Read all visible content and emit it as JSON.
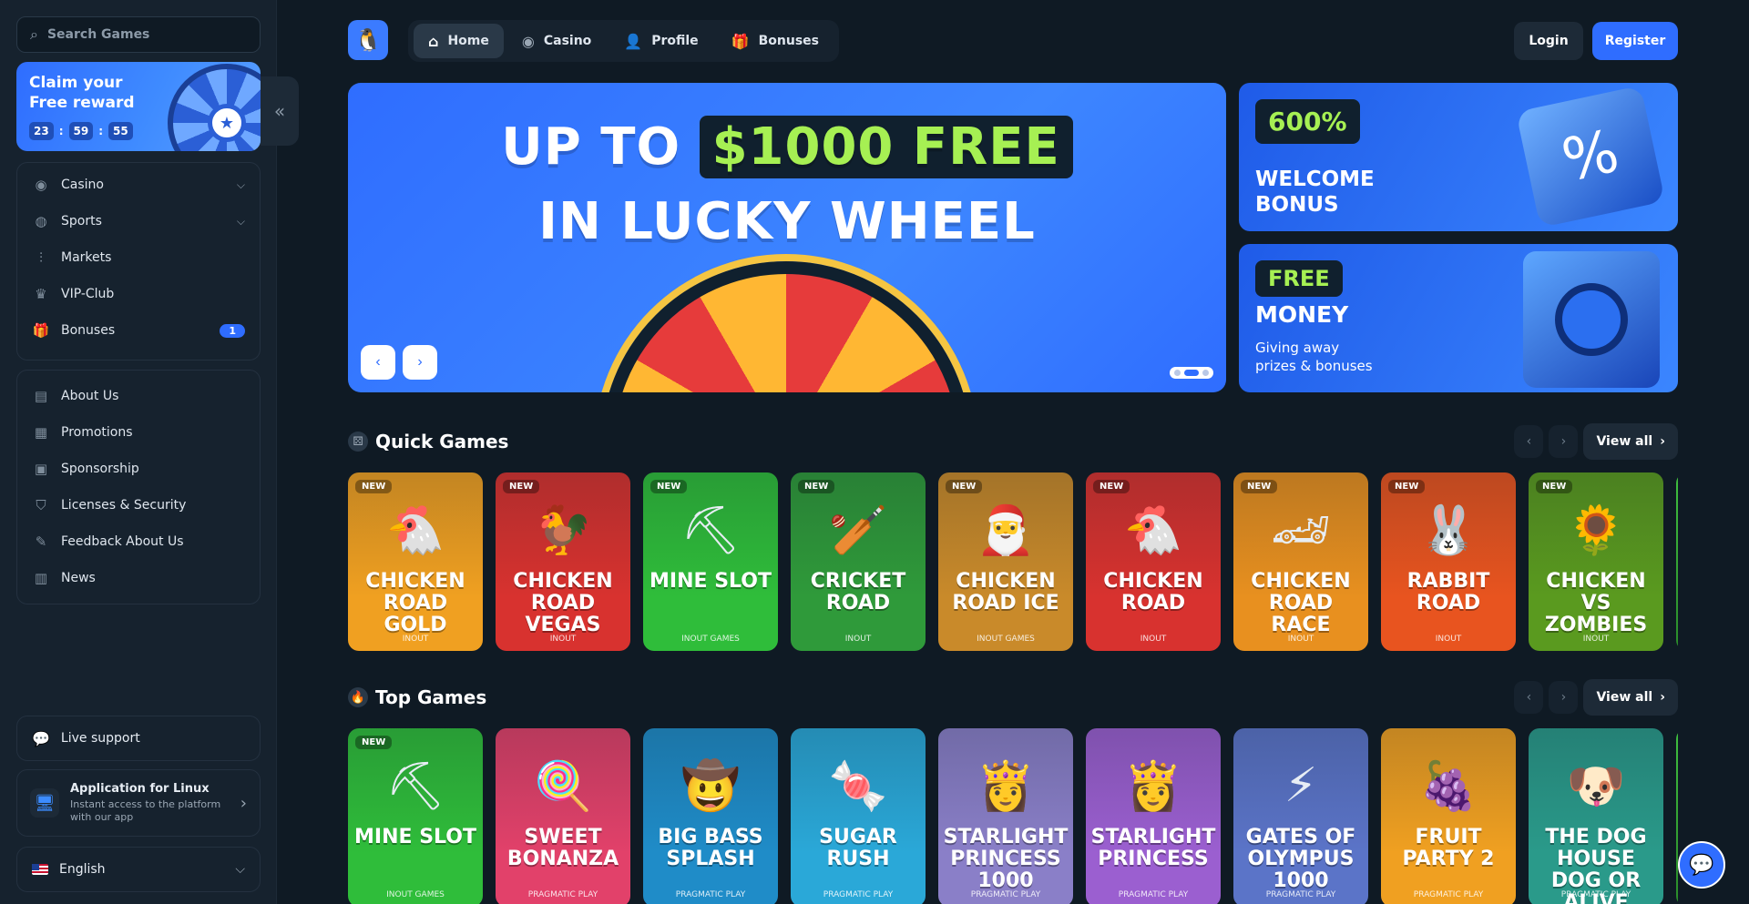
{
  "search": {
    "placeholder": "Search Games"
  },
  "reward": {
    "title": "Claim your Free reward",
    "hours": "23",
    "minutes": "59",
    "seconds": "55",
    "colon": ":"
  },
  "collapse_icon": "«",
  "nav_primary": [
    {
      "label": "Casino",
      "icon": "casino-chip-icon",
      "glyph": "◉",
      "chev": "⌵"
    },
    {
      "label": "Sports",
      "icon": "globe-icon",
      "glyph": "◍",
      "chev": "⌵"
    },
    {
      "label": "Markets",
      "icon": "markets-icon",
      "glyph": "⫶"
    },
    {
      "label": "VIP-Club",
      "icon": "crown-icon",
      "glyph": "♛"
    },
    {
      "label": "Bonuses",
      "icon": "gift-icon",
      "glyph": "🎁",
      "badge": "1"
    }
  ],
  "nav_secondary": [
    {
      "label": "About Us",
      "icon": "book-icon",
      "glyph": "▤"
    },
    {
      "label": "Promotions",
      "icon": "promotions-icon",
      "glyph": "▦"
    },
    {
      "label": "Sponsorship",
      "icon": "sponsorship-icon",
      "glyph": "▣"
    },
    {
      "label": "Licenses & Security",
      "icon": "shield-icon",
      "glyph": "⛉"
    },
    {
      "label": "Feedback About Us",
      "icon": "feedback-icon",
      "glyph": "✎"
    },
    {
      "label": "News",
      "icon": "news-icon",
      "glyph": "▥"
    }
  ],
  "support": {
    "label": "Live support",
    "glyph": "💬"
  },
  "app": {
    "title": "Application for Linux",
    "subtitle": "Instant access to the platform with our app",
    "glyph": "🖥",
    "chev": "›"
  },
  "language": {
    "label": "English",
    "chev": "⌵"
  },
  "topbar": {
    "logo": "🐧",
    "tabs": [
      {
        "label": "Home",
        "glyph": "⌂",
        "active": true
      },
      {
        "label": "Casino",
        "glyph": "◉"
      },
      {
        "label": "Profile",
        "glyph": "👤"
      },
      {
        "label": "Bonuses",
        "glyph": "🎁"
      }
    ],
    "login": "Login",
    "register": "Register"
  },
  "hero": {
    "line1_a": "UP TO",
    "line1_hl": "$1000 FREE",
    "line2": "IN LUCKY WHEEL",
    "prev": "‹",
    "next": "›"
  },
  "promo1": {
    "pill": "600%",
    "title1": "WELCOME",
    "title2": "BONUS",
    "glyph": "%"
  },
  "promo2": {
    "pill": "FREE",
    "title": "MONEY",
    "sub1": "Giving away",
    "sub2": "prizes & bonuses"
  },
  "quick_games": {
    "title": "Quick Games",
    "view_all": "View all",
    "prev": "‹",
    "next": "›",
    "items": [
      {
        "name": "CHICKEN ROAD GOLD",
        "provider": "INOUT",
        "new": "NEW",
        "glyph": "🐔",
        "color": "#f0a021"
      },
      {
        "name": "CHICKEN ROAD VEGAS",
        "provider": "INOUT",
        "new": "NEW",
        "glyph": "🐓",
        "color": "#d8322f"
      },
      {
        "name": "MINE SLOT",
        "provider": "INOUT GAMES",
        "new": "NEW",
        "glyph": "⛏",
        "color": "#2fbd3a"
      },
      {
        "name": "CRICKET ROAD",
        "provider": "INOUT",
        "new": "NEW",
        "glyph": "🏏",
        "color": "#2f9a3a"
      },
      {
        "name": "CHICKEN ROAD ICE",
        "provider": "INOUT GAMES",
        "new": "NEW",
        "glyph": "🎅",
        "color": "#c98a2a"
      },
      {
        "name": "CHICKEN ROAD",
        "provider": "INOUT",
        "new": "NEW",
        "glyph": "🐔",
        "color": "#d8322f"
      },
      {
        "name": "CHICKEN ROAD RACE",
        "provider": "INOUT",
        "new": "NEW",
        "glyph": "🏎",
        "color": "#e8901f"
      },
      {
        "name": "RABBIT ROAD",
        "provider": "INOUT",
        "new": "NEW",
        "glyph": "🐰",
        "color": "#e8541f"
      },
      {
        "name": "CHICKEN VS ZOMBIES",
        "provider": "INOUT",
        "new": "NEW",
        "glyph": "🌻",
        "color": "#5a9a1f"
      }
    ]
  },
  "top_games": {
    "title": "Top Games",
    "view_all": "View all",
    "prev": "‹",
    "next": "›",
    "items": [
      {
        "name": "MINE SLOT",
        "provider": "INOUT GAMES",
        "new": "NEW",
        "glyph": "⛏",
        "color": "#2fbd3a"
      },
      {
        "name": "SWEET BONANZA",
        "provider": "PRAGMATIC PLAY",
        "glyph": "🍭",
        "color": "#e2416a"
      },
      {
        "name": "BIG BASS SPLASH",
        "provider": "PRAGMATIC PLAY",
        "glyph": "🤠",
        "color": "#1f8cc8"
      },
      {
        "name": "SUGAR RUSH",
        "provider": "PRAGMATIC PLAY",
        "glyph": "🍬",
        "color": "#2aa8d8"
      },
      {
        "name": "STARLIGHT PRINCESS 1000",
        "provider": "PRAGMATIC PLAY",
        "glyph": "👸",
        "color": "#8a7fc8"
      },
      {
        "name": "STARLIGHT PRINCESS",
        "provider": "PRAGMATIC PLAY",
        "glyph": "👸",
        "color": "#9b5fd0"
      },
      {
        "name": "GATES OF OLYMPUS 1000",
        "provider": "PRAGMATIC PLAY",
        "glyph": "⚡",
        "color": "#5b74c8"
      },
      {
        "name": "FRUIT PARTY 2",
        "provider": "PRAGMATIC PLAY",
        "glyph": "🍇",
        "color": "#f0a021"
      },
      {
        "name": "THE DOG HOUSE DOG OR ALIVE",
        "provider": "PRAGMATIC PLAY",
        "glyph": "🐶",
        "color": "#2a9a8a"
      }
    ]
  },
  "chat": {
    "glyph": "💬"
  }
}
